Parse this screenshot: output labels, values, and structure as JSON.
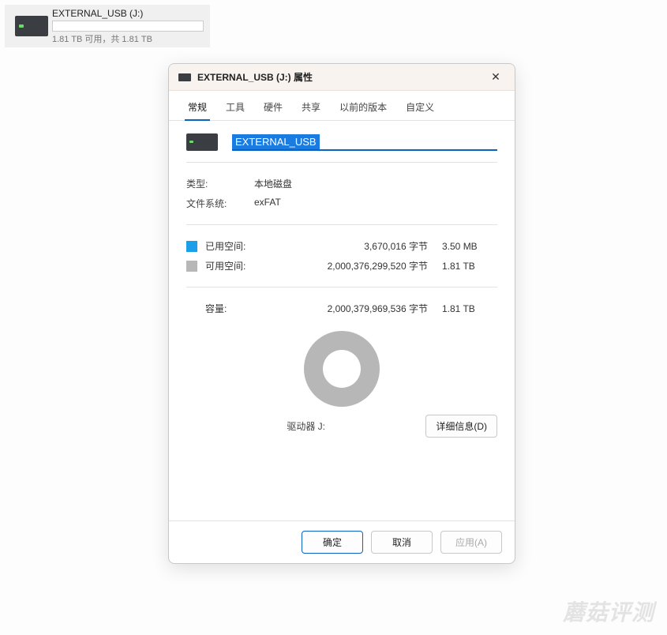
{
  "drive_tile": {
    "name": "EXTERNAL_USB (J:)",
    "space": "1.81 TB 可用，共 1.81 TB"
  },
  "dialog": {
    "title": "EXTERNAL_USB (J:) 属性",
    "tabs": {
      "general": "常规",
      "tools": "工具",
      "hardware": "硬件",
      "sharing": "共享",
      "previous": "以前的版本",
      "custom": "自定义"
    },
    "name_value": "EXTERNAL_USB",
    "type_label": "类型:",
    "type_value": "本地磁盘",
    "fs_label": "文件系统:",
    "fs_value": "exFAT",
    "used_label": "已用空间:",
    "used_bytes": "3,670,016 字节",
    "used_human": "3.50 MB",
    "free_label": "可用空间:",
    "free_bytes": "2,000,376,299,520 字节",
    "free_human": "1.81 TB",
    "capacity_label": "容量:",
    "capacity_bytes": "2,000,379,969,536 字节",
    "capacity_human": "1.81 TB",
    "drive_label": "驱动器 J:",
    "detail_btn": "详细信息(D)",
    "ok": "确定",
    "cancel": "取消",
    "apply": "应用(A)"
  },
  "colors": {
    "accent": "#0a63c2",
    "used": "#1a9fe8",
    "free": "#b7b7b7"
  },
  "watermark": "蘑菇评测",
  "chart_data": {
    "type": "pie",
    "title": "驱动器 J:",
    "series": [
      {
        "name": "已用空间",
        "value": 3670016,
        "human": "3.50 MB",
        "color": "#1a9fe8"
      },
      {
        "name": "可用空间",
        "value": 2000376299520,
        "human": "1.81 TB",
        "color": "#b7b7b7"
      }
    ],
    "total": {
      "name": "容量",
      "value": 2000379969536,
      "human": "1.81 TB"
    }
  }
}
